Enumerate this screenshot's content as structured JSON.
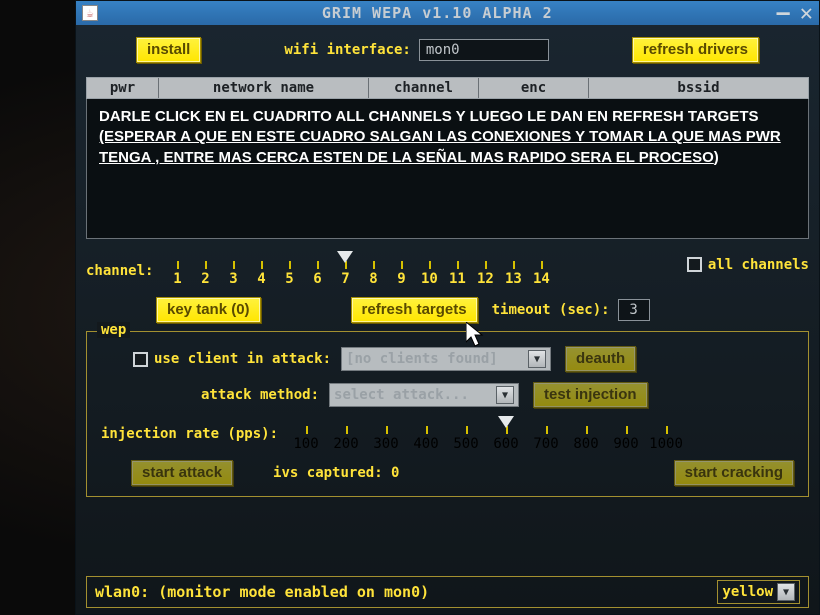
{
  "title": "GRIM WEPA v1.10 ALPHA 2",
  "toolbar": {
    "install": "install",
    "iface_label": "wifi interface:",
    "iface_value": "mon0",
    "refresh_drivers": "refresh drivers"
  },
  "columns": {
    "pwr": "pwr",
    "name": "network name",
    "channel": "channel",
    "enc": "enc",
    "bssid": "bssid"
  },
  "overlay_text": {
    "line1": "DARLE CLICK EN EL CUADRITO ALL CHANNELS Y LUEGO LE DAN EN REFRESH TARGETS ",
    "line2_u": "(ESPERAR A QUE EN ESTE CUADRO SALGAN LAS CONEXIONES Y TOMAR LA QUE MAS PWR TENGA , ENTRE MAS CERCA ESTEN DE LA SEÑAL MAS RAPIDO SERA EL PROCESO",
    "line2_end": ")"
  },
  "channel": {
    "label": "channel:",
    "ticks": [
      "1",
      "2",
      "3",
      "4",
      "5",
      "6",
      "7",
      "8",
      "9",
      "10",
      "11",
      "12",
      "13",
      "14"
    ],
    "all_label": "all channels",
    "key_tank": "key tank (0)",
    "refresh_targets": "refresh targets",
    "timeout_label": "timeout (sec):",
    "timeout_value": "3"
  },
  "wep": {
    "legend": "wep",
    "use_client_label": "use client in attack:",
    "clients_select": "[no clients found]",
    "deauth": "deauth",
    "method_label": "attack method:",
    "method_select": "select attack...",
    "test_injection": "test injection",
    "rate_label": "injection rate (pps):",
    "rate_ticks": [
      "100",
      "200",
      "300",
      "400",
      "500",
      "600",
      "700",
      "800",
      "900",
      "1000"
    ],
    "start_attack": "start attack",
    "ivs_label": "ivs captured: 0",
    "start_cracking": "start cracking"
  },
  "footer": {
    "status": "wlan0: (monitor mode enabled on mon0)",
    "color_select": "yellow"
  }
}
